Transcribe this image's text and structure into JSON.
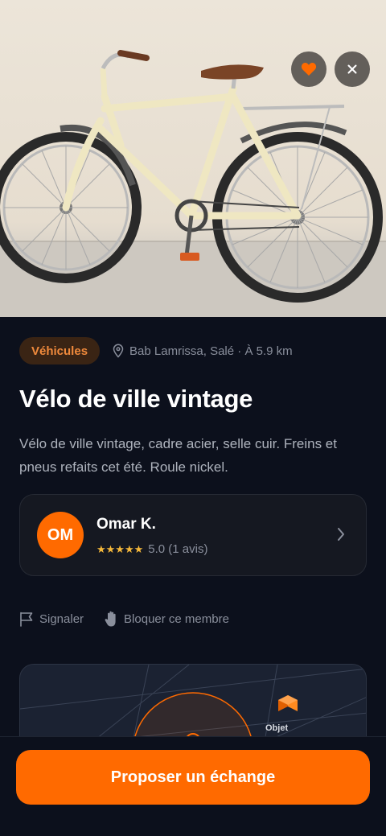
{
  "listing": {
    "category": "Véhicules",
    "location": "Bab Lamrissa, Salé · À 5.9 km",
    "title": "Vélo de ville vintage",
    "description": "Vélo de ville vintage, cadre acier, selle cuir. Freins et pneus refaits cet été. Roule nickel."
  },
  "seller": {
    "initials": "OM",
    "name": "Omar K.",
    "stars": "★★★★★",
    "rating": "5.0 (1 avis)"
  },
  "actions": {
    "report": "Signaler",
    "block": "Bloquer ce membre"
  },
  "map": {
    "object_label": "Objet"
  },
  "cta": {
    "label": "Proposer un échange"
  },
  "colors": {
    "accent": "#ff6a00",
    "background": "#0c101c",
    "category_bg": "#3a2414",
    "star": "#f6b93b"
  },
  "icons": {
    "favorite": "heart-icon",
    "close": "close-icon",
    "location": "location-pin-icon",
    "report": "flag-icon",
    "block": "hand-icon",
    "chevron": "chevron-right-icon",
    "map_object": "box-icon"
  }
}
